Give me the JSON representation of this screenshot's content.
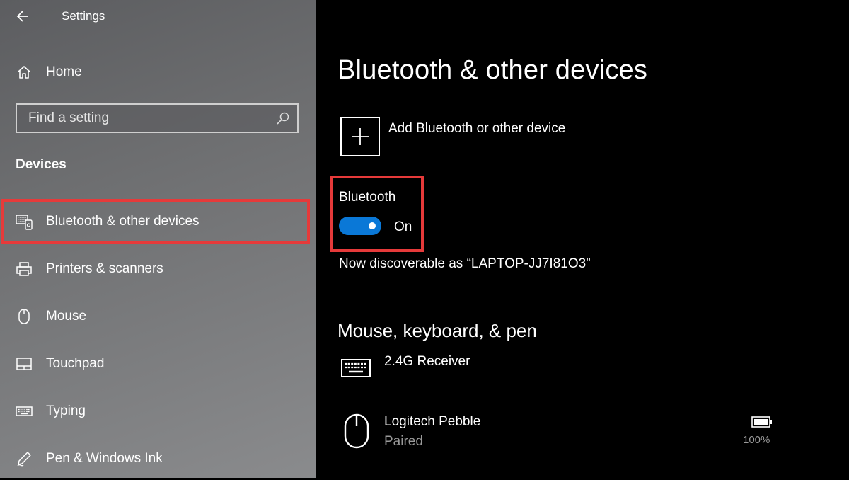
{
  "window": {
    "title": "Settings"
  },
  "sidebar": {
    "home_label": "Home",
    "search_placeholder": "Find a setting",
    "section": "Devices",
    "items": [
      {
        "label": "Bluetooth & other devices",
        "icon": "bluetooth-devices-icon",
        "selected": true
      },
      {
        "label": "Printers & scanners",
        "icon": "printer-icon"
      },
      {
        "label": "Mouse",
        "icon": "mouse-icon"
      },
      {
        "label": "Touchpad",
        "icon": "touchpad-icon"
      },
      {
        "label": "Typing",
        "icon": "keyboard-icon"
      },
      {
        "label": "Pen & Windows Ink",
        "icon": "pen-icon"
      }
    ]
  },
  "main": {
    "title": "Bluetooth & other devices",
    "add_device_label": "Add Bluetooth or other device",
    "bluetooth": {
      "label": "Bluetooth",
      "state": "On",
      "enabled": true
    },
    "discoverable_text": "Now discoverable as “LAPTOP-JJ7I81O3”",
    "section_title": "Mouse, keyboard, & pen",
    "devices": [
      {
        "name": "2.4G Receiver",
        "icon": "keyboard-icon"
      },
      {
        "name": "Logitech Pebble",
        "status": "Paired",
        "icon": "mouse-icon",
        "battery": "100%"
      }
    ]
  },
  "colors": {
    "accent": "#0a78d7",
    "highlight": "#e63a3a"
  }
}
